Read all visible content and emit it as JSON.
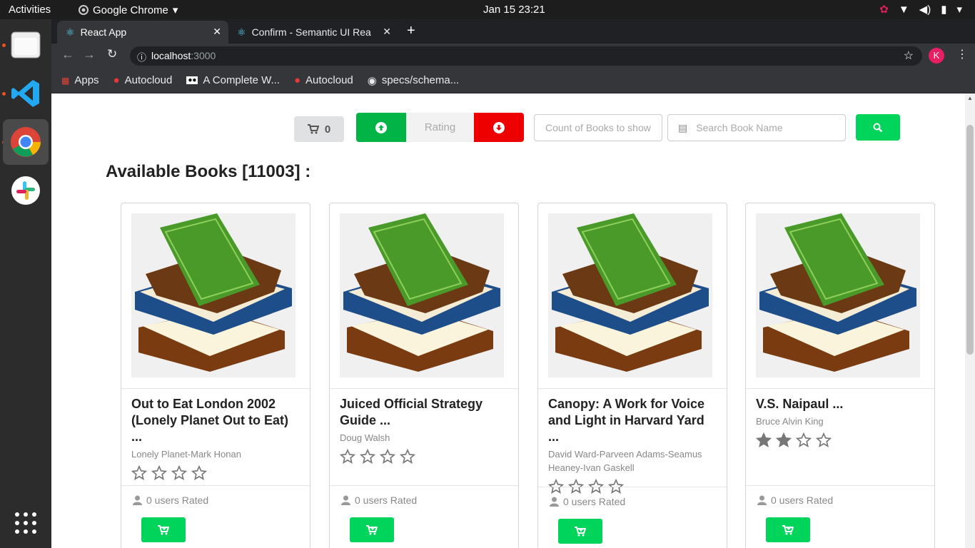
{
  "os": {
    "activities": "Activities",
    "app_menu": "Google Chrome",
    "clock": "Jan 15  23:21"
  },
  "browser": {
    "tabs": [
      {
        "title": "React App"
      },
      {
        "title": "Confirm - Semantic UI Rea"
      }
    ],
    "url_host": "localhost",
    "url_port": ":3000",
    "profile_initial": "K",
    "bookmarks": [
      "Apps",
      "Autocloud",
      "A Complete W...",
      "Autocloud",
      "specs/schema..."
    ]
  },
  "toolbar": {
    "cart_count": "0",
    "rating_label": "Rating",
    "count_placeholder": "Count of Books to show",
    "search_placeholder": "Search Book Name"
  },
  "main": {
    "heading": "Available Books [11003] :",
    "books": [
      {
        "title_line1": "Out to Eat London 2002",
        "title_line2": "(Lonely Planet Out to Eat)  ...",
        "author_line1": "Lonely Planet-Mark Honan",
        "author_line2": "",
        "rating": 0,
        "rated_text": "0 users Rated"
      },
      {
        "title_line1": "Juiced Official Strategy",
        "title_line2": "Guide  ...",
        "author_line1": "Doug Walsh",
        "author_line2": "",
        "rating": 0,
        "rated_text": "0 users Rated"
      },
      {
        "title_line1": "Canopy: A Work for Voice",
        "title_line2": "and Light in Harvard Yard  ...",
        "author_line1": "David Ward-Parveen Adams-Seamus",
        "author_line2": "Heaney-Ivan Gaskell",
        "rating": 0,
        "rated_text": "0 users Rated"
      },
      {
        "title_line1": "V.S. Naipaul  ...",
        "title_line2": "",
        "author_line1": "Bruce Alvin King",
        "author_line2": "",
        "rating": 2,
        "rated_text": "0 users Rated"
      }
    ]
  },
  "colors": {
    "green": "#00d45a",
    "red": "#ee0000",
    "green_dark": "#00b545"
  }
}
